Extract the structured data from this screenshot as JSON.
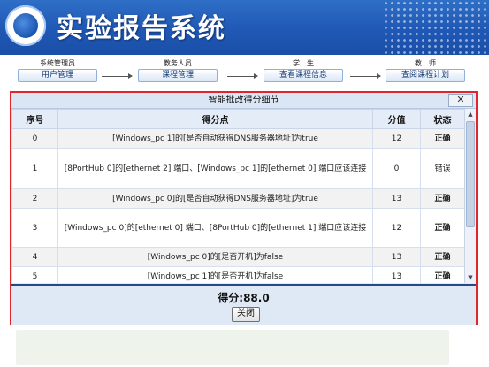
{
  "header": {
    "title": "实验报告系统"
  },
  "flow": {
    "steps": [
      {
        "role": "系统管理员",
        "button": "用户管理"
      },
      {
        "role": "教务人员",
        "button": "课程管理"
      },
      {
        "role": "学　生",
        "button": "查看课程信息"
      },
      {
        "role": "教　师",
        "button": "查阅课程计划"
      }
    ]
  },
  "dialog": {
    "title": "智能批改得分细节",
    "close_icon": "✕",
    "columns": [
      "序号",
      "得分点",
      "分值",
      "状态"
    ],
    "rows": [
      {
        "no": "0",
        "point": "[Windows_pc 1]的[是否自动获得DNS服务器地址]为true",
        "score": "12",
        "status": "正确"
      },
      {
        "no": "1",
        "point": "[8PortHub 0]的[ethernet 2] 端口、[Windows_pc 1]的[ethernet 0] 端口应该连接",
        "score": "0",
        "status": "错误"
      },
      {
        "no": "2",
        "point": "[Windows_pc 0]的[是否自动获得DNS服务器地址]为true",
        "score": "13",
        "status": "正确"
      },
      {
        "no": "3",
        "point": "[Windows_pc 0]的[ethernet 0] 端口、[8PortHub 0]的[ethernet 1] 端口应该连接",
        "score": "12",
        "status": "正确"
      },
      {
        "no": "4",
        "point": "[Windows_pc 0]的[是否开机]为false",
        "score": "13",
        "status": "正确"
      },
      {
        "no": "5",
        "point": "[Windows_pc 1]的[是否开机]为false",
        "score": "13",
        "status": "正确"
      }
    ],
    "total": "得分:88.0",
    "close_label": "关闭"
  },
  "colors": {
    "accent": "#1f58b5",
    "dialog_border": "#e0262b"
  }
}
